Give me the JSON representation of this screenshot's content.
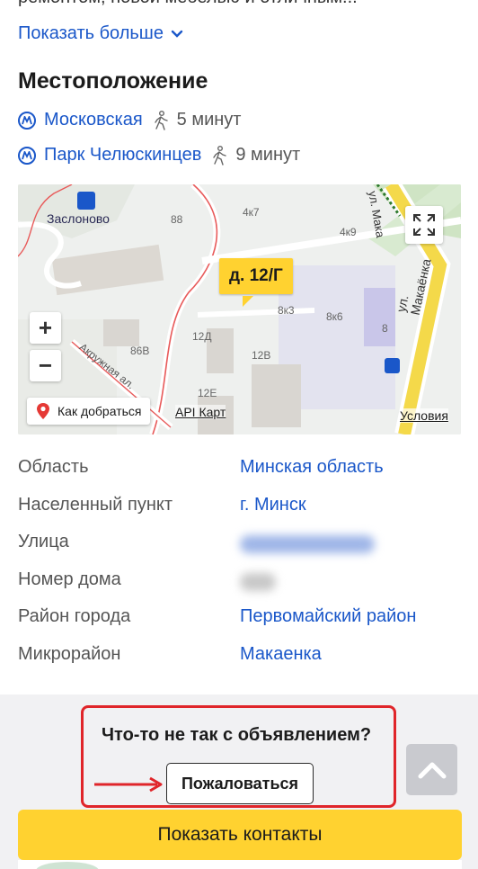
{
  "description": {
    "cut_text": "ремонтом, новой мебелью и отличным...",
    "show_more_label": "Показать больше"
  },
  "location": {
    "title": "Местоположение",
    "metro": [
      {
        "station": "Московская",
        "walk_time": "5 минут"
      },
      {
        "station": "Парк Челюскинцев",
        "walk_time": "9 минут"
      }
    ]
  },
  "map": {
    "marker_label": "д. 12/Г",
    "place_label": "Заслоново",
    "street_label_1": "ул. Макаёнка",
    "street_label_2": "Акружная ал.",
    "street_label_3": "ул. Мака",
    "building_labels": [
      "88",
      "4к7",
      "4к9",
      "8к3",
      "8к6",
      "8",
      "12Д",
      "86В",
      "12В",
      "12Е"
    ],
    "zoom_in": "+",
    "zoom_out": "−",
    "route_label": "Как добраться",
    "api_label": "API Карт",
    "terms_label": "Условия"
  },
  "params": [
    {
      "label": "Область",
      "value": "Минская область"
    },
    {
      "label": "Населенный пункт",
      "value": "г. Минск"
    },
    {
      "label": "Улица",
      "value": "",
      "blurred": "blue"
    },
    {
      "label": "Номер дома",
      "value": "",
      "blurred": "gray"
    },
    {
      "label": "Район города",
      "value": "Первомайский район"
    },
    {
      "label": "Микрорайон",
      "value": "Макаенка"
    }
  ],
  "report": {
    "question": "Что-то не так с объявлением?",
    "button_label": "Пожаловаться"
  },
  "contacts_button_label": "Показать контакты",
  "colors": {
    "link": "#1a57c9",
    "accent_yellow": "#ffd230",
    "annotation_red": "#e0252a"
  }
}
